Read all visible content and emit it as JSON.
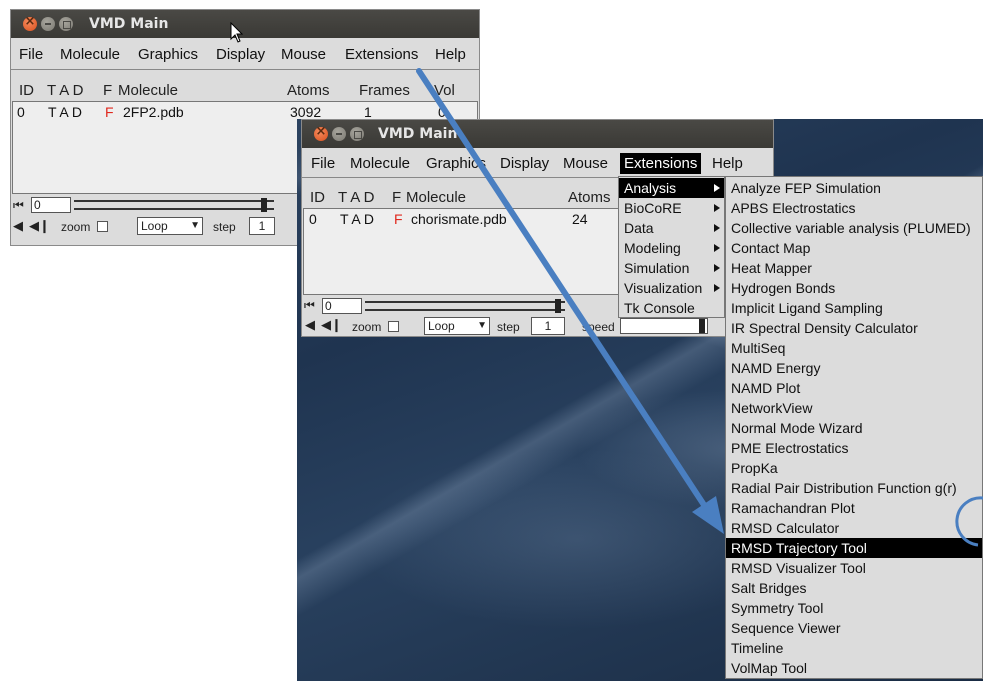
{
  "window1": {
    "title": "VMD Main",
    "menu": [
      "File",
      "Molecule",
      "Graphics",
      "Display",
      "Mouse",
      "Extensions",
      "Help"
    ],
    "columns": {
      "id": "ID",
      "tadf": "T A D",
      "f": "F",
      "molecule": "Molecule",
      "atoms": "Atoms",
      "frames": "Frames",
      "vol": "Vol"
    },
    "row": {
      "id": "0",
      "tad": "T A D",
      "f": "F",
      "molecule": "2FP2.pdb",
      "atoms": "3092",
      "frames": "1",
      "vol": "0"
    },
    "frame_value": "0",
    "zoom_label": "zoom",
    "loop_value": "Loop",
    "step_label": "step",
    "step_value": "1"
  },
  "window2": {
    "title": "VMD Main",
    "menu": [
      "File",
      "Molecule",
      "Graphics",
      "Display",
      "Mouse",
      "Extensions",
      "Help"
    ],
    "columns": {
      "id": "ID",
      "tadf": "T A D",
      "f": "F",
      "molecule": "Molecule",
      "atoms": "Atoms"
    },
    "row": {
      "id": "0",
      "tad": "T A D",
      "f": "F",
      "molecule": "chorismate.pdb",
      "atoms": "24"
    },
    "frame_value": "0",
    "zoom_label": "zoom",
    "loop_value": "Loop",
    "step_label": "step",
    "step_value": "1",
    "speed_label": "speed"
  },
  "extensions_menu": [
    "Analysis",
    "BioCoRE",
    "Data",
    "Modeling",
    "Simulation",
    "Visualization",
    "Tk Console"
  ],
  "analysis_menu": [
    "Analyze FEP Simulation",
    "APBS Electrostatics",
    "Collective variable analysis (PLUMED)",
    "Contact Map",
    "Heat Mapper",
    "Hydrogen Bonds",
    "Implicit Ligand Sampling",
    "IR Spectral Density Calculator",
    "MultiSeq",
    "NAMD Energy",
    "NAMD Plot",
    "NetworkView",
    "Normal Mode Wizard",
    "PME Electrostatics",
    "PropKa",
    "Radial Pair Distribution Function g(r)",
    "Ramachandran Plot",
    "RMSD Calculator",
    "RMSD Trajectory Tool",
    "RMSD Visualizer Tool",
    "Salt Bridges",
    "Symmetry Tool",
    "Sequence Viewer",
    "Timeline",
    "VolMap Tool"
  ],
  "colors": {
    "arrow": "#4a7fc1",
    "highlight": "#000000",
    "red_flag": "#e0281e"
  }
}
